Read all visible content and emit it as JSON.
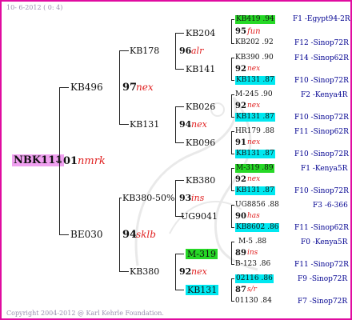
{
  "header": "10- 6-2012 ( 0: 4)",
  "footer": "Copyright 2004-2012 @ Karl Kehrle Foundation.",
  "colors": {
    "border": "#e00ca0",
    "cyan": "#00e8f0",
    "green": "#26d826",
    "pink": "#f0a0f0",
    "tag": "#e02020",
    "right_text": "#000090"
  },
  "root": {
    "name": "NBK111",
    "year": "01",
    "tag": "nmrk"
  },
  "gen1": [
    {
      "name": "KB496",
      "year": "97",
      "tag": "nex"
    },
    {
      "name": "BE030",
      "year": "94",
      "tag": "sklb"
    }
  ],
  "gen2": [
    {
      "name": "KB178",
      "year": "96",
      "tag": "alr"
    },
    {
      "name": "KB131",
      "year": "94",
      "tag": "nex"
    },
    {
      "name": "KB380-50%",
      "year": "93",
      "tag": "ins"
    },
    {
      "name": "KB380",
      "year": "92",
      "tag": "nex"
    }
  ],
  "gen3": [
    {
      "name": "KB204"
    },
    {
      "name": "KB141"
    },
    {
      "name": "KB026"
    },
    {
      "name": "KB096"
    },
    {
      "name": "KB380"
    },
    {
      "name": "UG9041"
    },
    {
      "name": "M-319"
    },
    {
      "name": "KB131"
    }
  ],
  "gen4": [
    {
      "sire": "KB419 .94",
      "year": "95",
      "tag": "fun",
      "dam": "KB202 .92",
      "sire_info": "F1 -Egypt94-2R",
      "dam_info": "F12 -Sinop72R"
    },
    {
      "sire": "KB390 .90",
      "year": "92",
      "tag": "nex",
      "dam": "KB131 .87",
      "sire_info": "F14 -Sinop62R",
      "dam_info": "F10 -Sinop72R"
    },
    {
      "sire": "M-245 .90",
      "year": "92",
      "tag": "nex",
      "dam": "KB131 .87",
      "sire_info": "F2 -Kenya4R",
      "dam_info": "F10 -Sinop72R"
    },
    {
      "sire": "HR179 .88",
      "year": "91",
      "tag": "nex",
      "dam": "KB131 .87",
      "sire_info": "F11 -Sinop62R",
      "dam_info": "F10 -Sinop72R"
    },
    {
      "sire": "M-319 .89",
      "year": "92",
      "tag": "nex",
      "dam": "KB131 .87",
      "sire_info": "F1 -Kenya5R",
      "dam_info": "F10 -Sinop72R"
    },
    {
      "sire": "UG8856 .88",
      "year": "90",
      "tag": "has",
      "dam": "KB8602 .86",
      "sire_info": "F3 -6-366",
      "dam_info": "F11 -Sinop62R"
    },
    {
      "sire": "M-5 .88",
      "year": "89",
      "tag": "ins",
      "dam": "B-123 .86",
      "sire_info": "F0 -Kenya5R",
      "dam_info": "F11 -Sinop72R"
    },
    {
      "sire": "02116 .86",
      "year": "87",
      "tag": "s/r",
      "dam": "01130 .84",
      "sire_info": "F9 -Sinop72R",
      "dam_info": "F7 -Sinop72R"
    }
  ]
}
